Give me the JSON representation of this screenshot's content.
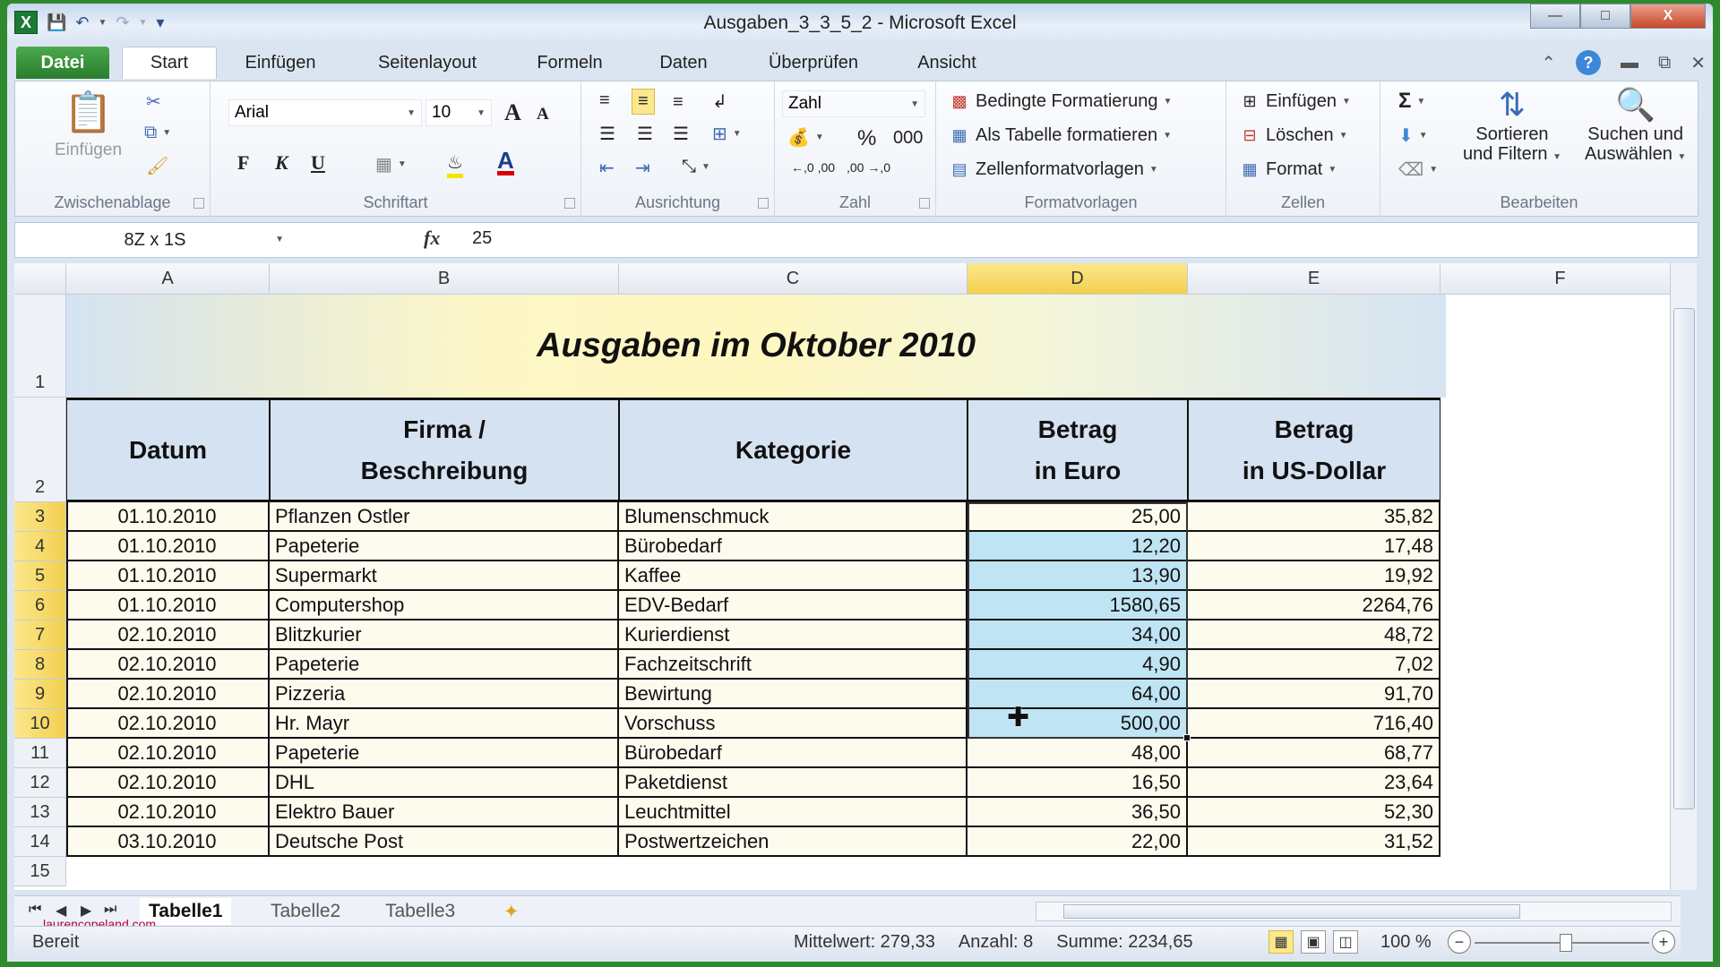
{
  "window": {
    "title": "Ausgaben_3_3_5_2 - Microsoft Excel",
    "controls": [
      "minimize",
      "maximize",
      "close"
    ]
  },
  "quick_access": {
    "icons": [
      "excel-logo",
      "save",
      "undo",
      "redo",
      "customize"
    ]
  },
  "ribbon_tabs": [
    {
      "label": "Datei",
      "type": "file"
    },
    {
      "label": "Start",
      "active": true
    },
    {
      "label": "Einfügen"
    },
    {
      "label": "Seitenlayout"
    },
    {
      "label": "Formeln"
    },
    {
      "label": "Daten"
    },
    {
      "label": "Überprüfen"
    },
    {
      "label": "Ansicht"
    }
  ],
  "ribbon": {
    "clipboard": {
      "label": "Zwischenablage",
      "paste": "Einfügen"
    },
    "font": {
      "label": "Schriftart",
      "font_name": "Arial",
      "font_size": "10",
      "bold": "F",
      "italic": "K",
      "underline": "U",
      "grow": "A",
      "shrink": "A"
    },
    "alignment": {
      "label": "Ausrichtung"
    },
    "number": {
      "label": "Zahl",
      "format": "Zahl",
      "percent": "%",
      "thousands": "000",
      "inc_decimal": "←,0 ,00",
      "dec_decimal": ",00 →,0"
    },
    "styles": {
      "label": "Formatvorlagen",
      "conditional": "Bedingte Formatierung",
      "as_table": "Als Tabelle formatieren",
      "cell_styles": "Zellenformatvorlagen"
    },
    "cells": {
      "label": "Zellen",
      "insert": "Einfügen",
      "delete": "Löschen",
      "format": "Format"
    },
    "editing": {
      "label": "Bearbeiten",
      "sigma": "Σ",
      "sort_line1": "Sortieren",
      "sort_line2": "und Filtern",
      "find_line1": "Suchen und",
      "find_line2": "Auswählen"
    }
  },
  "formula_bar": {
    "name_box": "8Z x 1S",
    "fx": "fx",
    "value": "25"
  },
  "columns": [
    "A",
    "B",
    "C",
    "D",
    "E",
    "F"
  ],
  "selected_column": "D",
  "sheet": {
    "title": "Ausgaben im Oktober 2010",
    "headers": [
      {
        "line1": "Datum",
        "line2": ""
      },
      {
        "line1": "Firma /",
        "line2": "Beschreibung"
      },
      {
        "line1": "Kategorie",
        "line2": ""
      },
      {
        "line1": "Betrag",
        "line2": "in Euro"
      },
      {
        "line1": "Betrag",
        "line2": "in US-Dollar"
      }
    ],
    "rows": [
      {
        "row": "3",
        "datum": "01.10.2010",
        "firma": "Pflanzen Ostler",
        "kategorie": "Blumenschmuck",
        "euro": "25,00",
        "usd": "35,82"
      },
      {
        "row": "4",
        "datum": "01.10.2010",
        "firma": "Papeterie",
        "kategorie": "Bürobedarf",
        "euro": "12,20",
        "usd": "17,48"
      },
      {
        "row": "5",
        "datum": "01.10.2010",
        "firma": "Supermarkt",
        "kategorie": "Kaffee",
        "euro": "13,90",
        "usd": "19,92"
      },
      {
        "row": "6",
        "datum": "01.10.2010",
        "firma": "Computershop",
        "kategorie": "EDV-Bedarf",
        "euro": "1580,65",
        "usd": "2264,76"
      },
      {
        "row": "7",
        "datum": "02.10.2010",
        "firma": "Blitzkurier",
        "kategorie": "Kurierdienst",
        "euro": "34,00",
        "usd": "48,72"
      },
      {
        "row": "8",
        "datum": "02.10.2010",
        "firma": "Papeterie",
        "kategorie": "Fachzeitschrift",
        "euro": "4,90",
        "usd": "7,02"
      },
      {
        "row": "9",
        "datum": "02.10.2010",
        "firma": "Pizzeria",
        "kategorie": "Bewirtung",
        "euro": "64,00",
        "usd": "91,70"
      },
      {
        "row": "10",
        "datum": "02.10.2010",
        "firma": "Hr. Mayr",
        "kategorie": "Vorschuss",
        "euro": "500,00",
        "usd": "716,40"
      },
      {
        "row": "11",
        "datum": "02.10.2010",
        "firma": "Papeterie",
        "kategorie": "Bürobedarf",
        "euro": "48,00",
        "usd": "68,77"
      },
      {
        "row": "12",
        "datum": "02.10.2010",
        "firma": "DHL",
        "kategorie": "Paketdienst",
        "euro": "16,50",
        "usd": "23,64"
      },
      {
        "row": "13",
        "datum": "02.10.2010",
        "firma": "Elektro Bauer",
        "kategorie": "Leuchtmittel",
        "euro": "36,50",
        "usd": "52,30"
      },
      {
        "row": "14",
        "datum": "03.10.2010",
        "firma": "Deutsche Post",
        "kategorie": "Postwertzeichen",
        "euro": "22,00",
        "usd": "31,52"
      }
    ],
    "selected_rows": [
      "3",
      "4",
      "5",
      "6",
      "7",
      "8",
      "9",
      "10"
    ],
    "empty_row": "15"
  },
  "sheet_tabs": [
    {
      "label": "Tabelle1",
      "active": true
    },
    {
      "label": "Tabelle2"
    },
    {
      "label": "Tabelle3"
    }
  ],
  "watermark": "laurencopeland.com",
  "status_bar": {
    "ready": "Bereit",
    "average": "Mittelwert: 279,33",
    "count": "Anzahl: 8",
    "sum": "Summe: 2234,65",
    "zoom": "100 %"
  },
  "colors": {
    "selection_fill": "#bfe4f3",
    "header_fill": "#d5e2f2",
    "cell_fill": "#fdfaee",
    "file_tab": "#2a7d2d",
    "selected_header": "#f3cf4e"
  }
}
